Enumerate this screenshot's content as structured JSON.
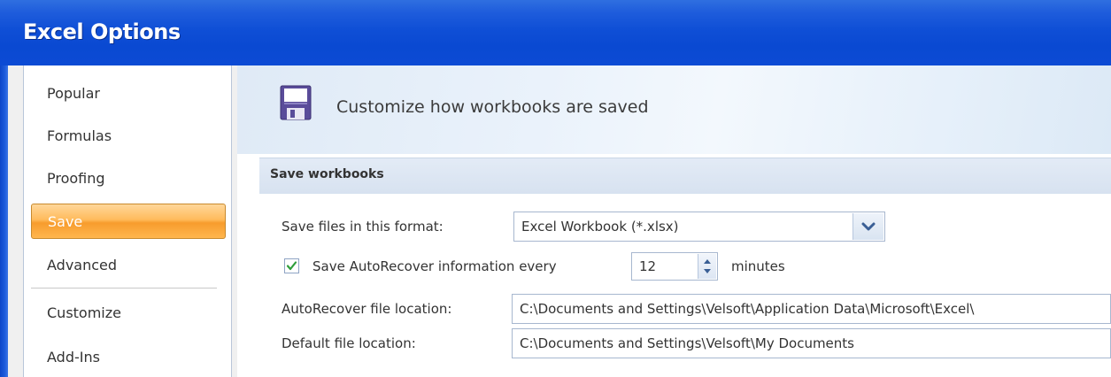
{
  "window": {
    "title": "Excel Options"
  },
  "nav": {
    "items": [
      {
        "label": "Popular"
      },
      {
        "label": "Formulas"
      },
      {
        "label": "Proofing"
      },
      {
        "label": "Save",
        "selected": true
      },
      {
        "label": "Advanced"
      },
      {
        "label": "Customize"
      },
      {
        "label": "Add-Ins"
      }
    ]
  },
  "header": {
    "text": "Customize how workbooks are saved",
    "icon": "floppy-disk-icon"
  },
  "section": {
    "title": "Save workbooks"
  },
  "form": {
    "format_label": "Save files in this format:",
    "format_value": "Excel Workbook (*.xlsx)",
    "autorecover_checked": true,
    "autorecover_label": "Save AutoRecover information every",
    "autorecover_minutes": "12",
    "minutes_label": "minutes",
    "autorecover_location_label": "AutoRecover file location:",
    "autorecover_location_value": "C:\\Documents and Settings\\Velsoft\\Application Data\\Microsoft\\Excel\\",
    "default_location_label": "Default file location:",
    "default_location_value": "C:\\Documents and Settings\\Velsoft\\My Documents"
  },
  "colors": {
    "titlebar": "#0a49d2",
    "selected_nav": "#f79c2d",
    "section_header": "#d7e2f0"
  }
}
